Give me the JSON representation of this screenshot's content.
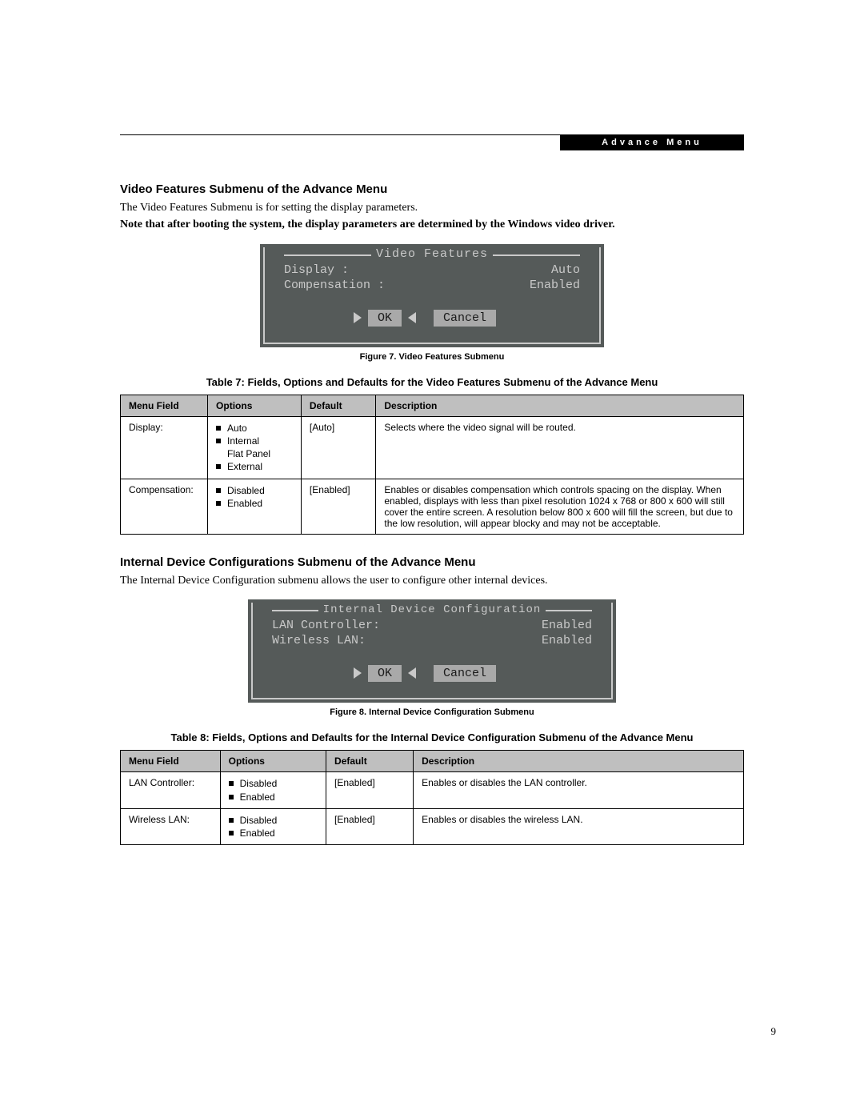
{
  "header": {
    "tab": "Advance Menu"
  },
  "section1": {
    "heading": "Video Features Submenu of the Advance Menu",
    "p1": "The Video Features Submenu is for setting the display parameters.",
    "p2": "Note that after booting the system, the display parameters are determined by the Windows video driver."
  },
  "bios1": {
    "title": "Video Features",
    "rows": [
      {
        "label": "Display :",
        "value": "Auto"
      },
      {
        "label": "Compensation :",
        "value": "Enabled"
      }
    ],
    "ok": "OK",
    "cancel": "Cancel"
  },
  "fig1_caption": "Figure 7.  Video Features Submenu",
  "table1_caption": "Table 7: Fields, Options and Defaults for the Video Features Submenu of the Advance Menu",
  "table_headers": {
    "menu": "Menu Field",
    "options": "Options",
    "default": "Default",
    "description": "Description"
  },
  "table1": {
    "rows": [
      {
        "menu": "Display:",
        "options": [
          "Auto",
          "Internal Flat Panel",
          "External"
        ],
        "optionSubFlags": [
          false,
          true,
          false
        ],
        "default": "[Auto]",
        "description": "Selects where the video signal will be routed."
      },
      {
        "menu": "Compensation:",
        "options": [
          "Disabled",
          "Enabled"
        ],
        "optionSubFlags": [
          false,
          false
        ],
        "default": "[Enabled]",
        "description": "Enables or disables compensation which controls spacing on the display. When enabled, displays with less than pixel resolution 1024 x 768 or 800 x 600 will still cover the entire screen. A resolution below 800 x 600 will fill the screen, but due to the low resolution, will appear blocky and may not be acceptable."
      }
    ]
  },
  "section2": {
    "heading": "Internal Device Configurations Submenu of the Advance Menu",
    "p1": "The Internal Device Configuration submenu allows the user to configure other internal devices."
  },
  "bios2": {
    "title": "Internal Device Configuration",
    "rows": [
      {
        "label": "LAN Controller:",
        "value": "Enabled"
      },
      {
        "label": "Wireless LAN:",
        "value": "Enabled"
      }
    ],
    "ok": "OK",
    "cancel": "Cancel"
  },
  "fig2_caption": "Figure 8.  Internal Device Configuration Submenu",
  "table2_caption": "Table 8: Fields, Options and Defaults for the Internal Device Configuration Submenu of the Advance Menu",
  "table2": {
    "rows": [
      {
        "menu": "LAN Controller:",
        "options": [
          "Disabled",
          "Enabled"
        ],
        "default": "[Enabled]",
        "description": "Enables or disables the LAN controller."
      },
      {
        "menu": "Wireless LAN:",
        "options": [
          "Disabled",
          "Enabled"
        ],
        "default": "[Enabled]",
        "description": "Enables or disables the wireless LAN."
      }
    ]
  },
  "page_number": "9"
}
